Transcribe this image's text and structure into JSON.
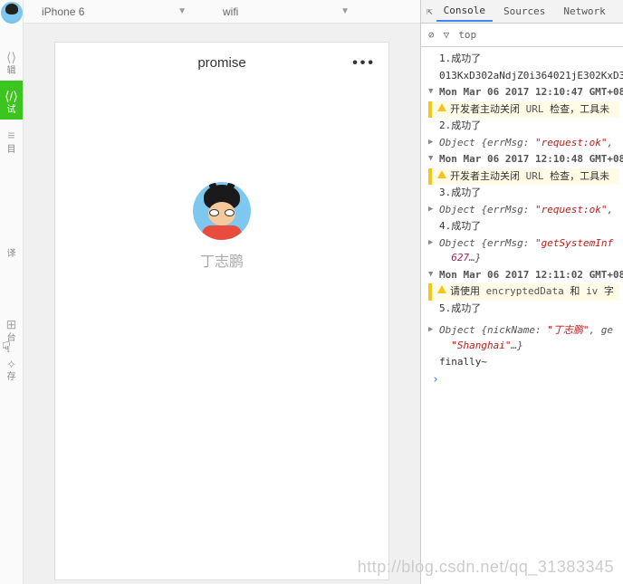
{
  "sidebar": {
    "items": [
      {
        "icon": "⟨⟩",
        "label": "辑"
      },
      {
        "icon": "⟨/⟩",
        "label": "试"
      },
      {
        "icon": "≡",
        "label": "目"
      },
      {
        "icon": "",
        "label": "译"
      },
      {
        "icon": "⊞",
        "label": "台"
      },
      {
        "icon": "⟡",
        "label": "存"
      }
    ]
  },
  "topbar": {
    "device": "iPhone 6",
    "network": "wifi"
  },
  "phone": {
    "title": "promise",
    "nickname": "丁志鹏"
  },
  "devtools": {
    "tabs": [
      "Console",
      "Sources",
      "Network"
    ],
    "active_tab": "Console",
    "filter_label": "top",
    "logs": {
      "l1": "1.成功了",
      "l2": "013KxD302aNdjZ0i364021jE302KxD3",
      "g1": "Mon Mar 06 2017 12:10:47 GMT+08",
      "w1a": "开发者主动关闭 ",
      "w1b": "URL",
      "w1c": " 检查，工具未",
      "l3": "2.成功了",
      "o1a": "Object ",
      "o1b": "{errMsg: ",
      "o1c": "\"request:ok\"",
      "o1d": ",",
      "g2": "Mon Mar 06 2017 12:10:48 GMT+08",
      "l4": "3.成功了",
      "l5": "4.成功了",
      "o2a": "Object ",
      "o2b": "{errMsg: ",
      "o2c": "\"getSystemInf",
      "o2d_num": "627",
      "o2d_rest": "…}",
      "g3": "Mon Mar 06 2017 12:11:02 GMT+08",
      "w2a": "请使用 ",
      "w2b": "encryptedData",
      "w2c": " 和 ",
      "w2d": "iv",
      "w2e": " 字",
      "l6": "5.成功了",
      "o3a": "Object ",
      "o3b": "{nickName: ",
      "o3c": "\"丁志鹏\"",
      "o3d": ", ge",
      "o3e": "\"Shanghai\"",
      "o3f": "…}",
      "fin": "finally~"
    }
  },
  "watermark": "http://blog.csdn.net/qq_31383345"
}
